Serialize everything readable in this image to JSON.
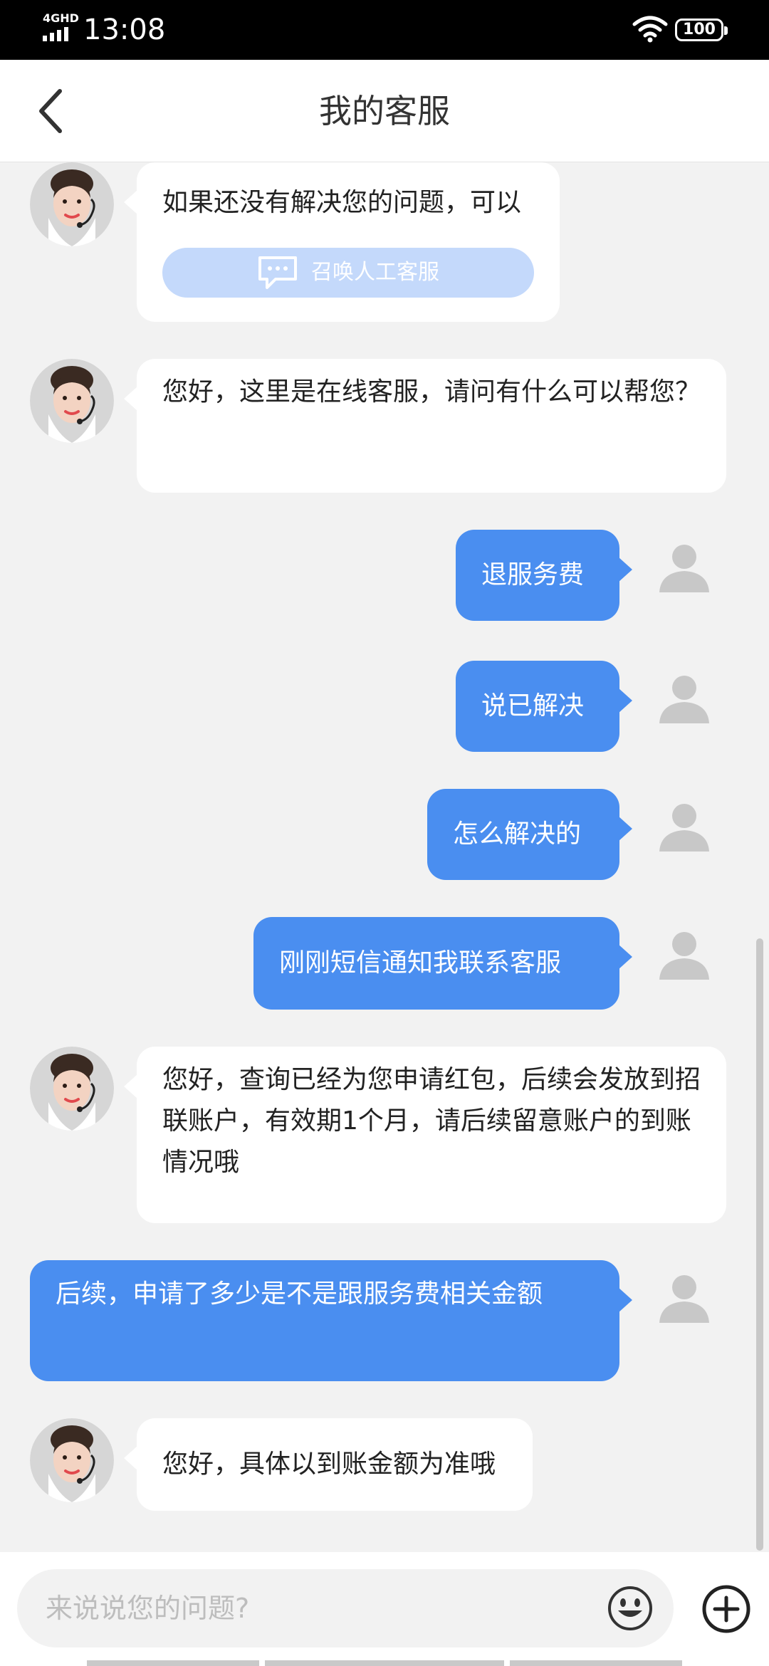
{
  "status_bar": {
    "network": "4GHD",
    "time": "13:08",
    "battery": "100"
  },
  "header": {
    "title": "我的客服"
  },
  "messages": [
    {
      "from": "agent",
      "text": "如果还没有解决您的问题，可以",
      "action_label": "召唤人工客服"
    },
    {
      "from": "agent",
      "text": "您好，这里是在线客服，请问有什么可以帮您？"
    },
    {
      "from": "user",
      "text": "退服务费"
    },
    {
      "from": "user",
      "text": "说已解决"
    },
    {
      "from": "user",
      "text": "怎么解决的"
    },
    {
      "from": "user",
      "text": "刚刚短信通知我联系客服"
    },
    {
      "from": "agent",
      "text": "您好，查询已经为您申请红包，后续会发放到招联账户，有效期1个月，请后续留意账户的到账情况哦"
    },
    {
      "from": "user",
      "text": "后续，申请了多少是不是跟服务费相关金额"
    },
    {
      "from": "agent",
      "text": "您好，具体以到账金额为准哦"
    }
  ],
  "input": {
    "placeholder": "来说说您的问题?",
    "value": ""
  },
  "colors": {
    "accent": "#4a8ef0",
    "summon_button": "#c4d9fb",
    "chat_background": "#f2f2f2"
  },
  "icons": [
    "back-icon",
    "emoji-icon",
    "plus-icon",
    "chat-bubble-icon",
    "wifi-icon",
    "battery-icon"
  ]
}
